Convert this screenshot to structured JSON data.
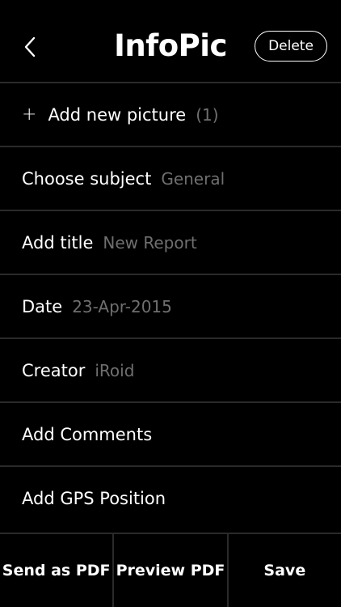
{
  "header": {
    "title": "InfoPic",
    "delete_label": "Delete"
  },
  "rows": [
    {
      "label": "Add new picture",
      "value": "(1)",
      "icon": "plus-icon",
      "prefix": "+"
    },
    {
      "label": "Choose subject",
      "value": "General"
    },
    {
      "label": "Add title",
      "value": "New Report"
    },
    {
      "label": "Date",
      "value": "23-Apr-2015"
    },
    {
      "label": "Creator",
      "value": "iRoid"
    },
    {
      "label": "Add Comments",
      "value": ""
    },
    {
      "label": "Add GPS Position",
      "value": ""
    }
  ],
  "toolbar": {
    "send_pdf": "Send as PDF",
    "preview_pdf": "Preview PDF",
    "save": "Save"
  },
  "colors": {
    "background": "#000000",
    "divider": "#2a2a2a",
    "value_text": "#6f6f6f"
  }
}
